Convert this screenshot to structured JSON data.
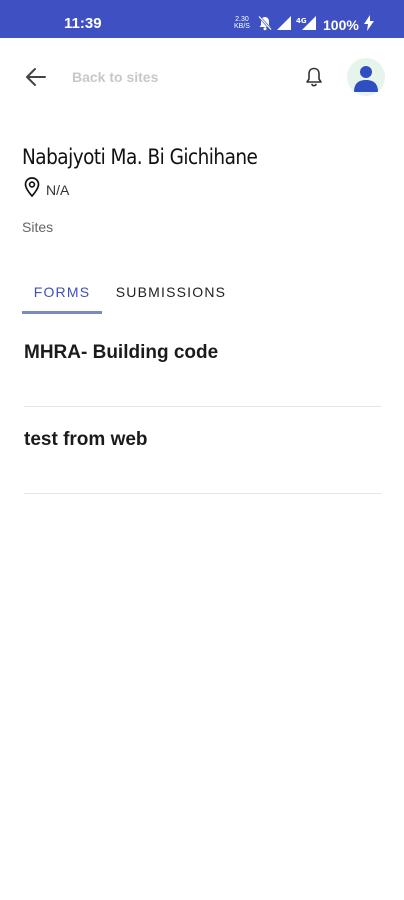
{
  "status_bar": {
    "time": "11:39",
    "net_speed_value": "2.30",
    "net_speed_unit": "KB/S",
    "battery": "100%",
    "background_color": "#3f51c2",
    "icons": [
      "mute-icon",
      "signal-icon",
      "wifi-icon",
      "battery-charging-icon"
    ]
  },
  "appbar": {
    "back_label": "Back to sites",
    "back_icon": "arrow-left-icon",
    "bell_icon": "bell-icon",
    "avatar_icon": "user-avatar-icon",
    "avatar_color": "#2f4fc0"
  },
  "site": {
    "title": "Nabajyoti Ma. Bi Gichihane",
    "location": "N/A",
    "location_icon": "location-pin-icon",
    "section_label": "Sites"
  },
  "tabs": [
    {
      "label": "FORMS",
      "active": true
    },
    {
      "label": "SUBMISSIONS",
      "active": false
    }
  ],
  "accent_color": "#3f51b5",
  "forms": [
    {
      "name": "MHRA- Building code"
    },
    {
      "name": "test from web"
    }
  ]
}
